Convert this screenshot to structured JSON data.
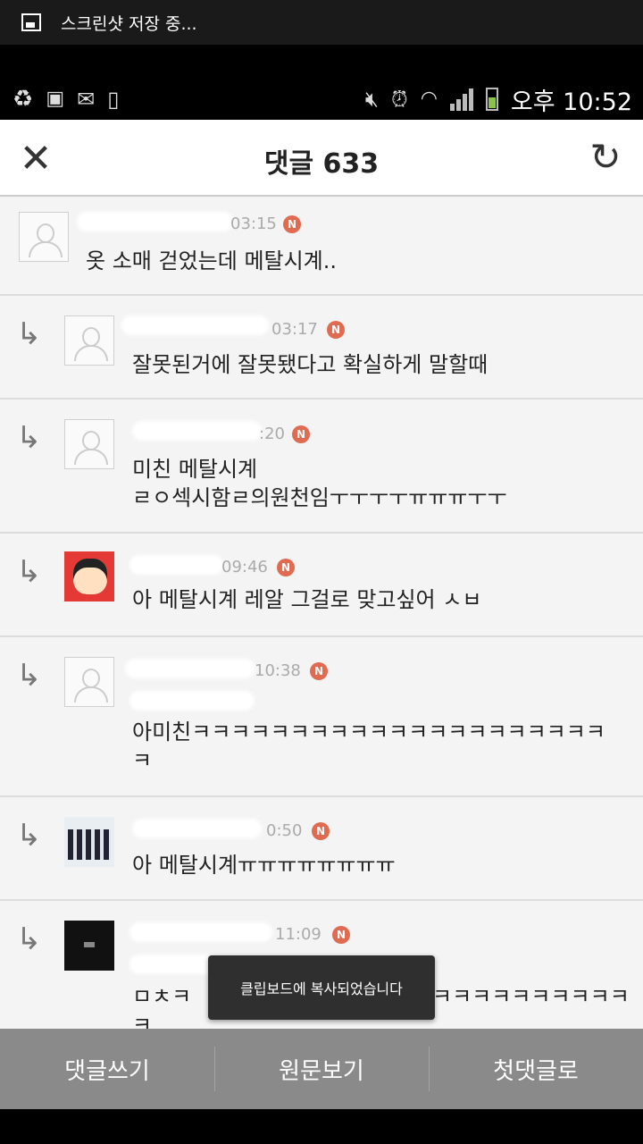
{
  "notification": {
    "text": "스크린샷 저장 중..."
  },
  "status_bar": {
    "left_icons": [
      "recycle-icon",
      "image-icon",
      "gmail-icon",
      "phone-icon"
    ],
    "right_icons": [
      "mute-icon",
      "alarm-icon",
      "wifi-icon",
      "signal-icon",
      "battery-icon"
    ],
    "time": "오후 10:52"
  },
  "header": {
    "title": "댓글 633",
    "close_icon": "close-icon",
    "refresh_icon": "refresh-icon"
  },
  "comments": [
    {
      "time": "03:15",
      "text_lines": [
        "옷 소매 걷었는데 메탈시계.."
      ],
      "reply": false,
      "avatar": "default"
    },
    {
      "time": "03:17",
      "text_lines": [
        "잘못된거에 잘못됐다고 확실하게 말할때"
      ],
      "reply": true,
      "avatar": "default"
    },
    {
      "time": ":20",
      "text_lines": [
        "미친 메탈시계",
        "ㄹㅇ섹시함ㄹ의원천임ㅜㅜㅜㅜㅠㅠㅠㅜㅜ"
      ],
      "reply": true,
      "avatar": "default"
    },
    {
      "time": "09:46",
      "text_lines": [
        "아 메탈시계 레알 그걸로 맞고싶어 ㅅㅂ"
      ],
      "reply": true,
      "avatar": "cartoon"
    },
    {
      "time": "10:38",
      "text_lines": [
        "아미친ㅋㅋㅋㅋㅋㅋㅋㅋㅋㅋㅋㅋㅋㅋㅋㅋㅋㅋㅋㅋㅋ",
        "ㅋ"
      ],
      "reply": true,
      "avatar": "default"
    },
    {
      "time": "0:50",
      "text_lines": [
        "아 메탈시계ㅠㅠㅠㅠㅠㅠㅠㅠ"
      ],
      "reply": true,
      "avatar": "photo"
    },
    {
      "time": "11:09",
      "text_lines": [
        "ㅁㅊㅋ",
        "ㅋ"
      ],
      "text_right": "ㅋㅋㅋㅋㅋㅋㅋㅋㅋㅋ",
      "reply": true,
      "avatar": "dark"
    }
  ],
  "badge_letter": "N",
  "toast": {
    "text": "클립보드에 복사되었습니다"
  },
  "bottom_bar": {
    "write": "댓글쓰기",
    "original": "원문보기",
    "first": "첫댓글로"
  }
}
